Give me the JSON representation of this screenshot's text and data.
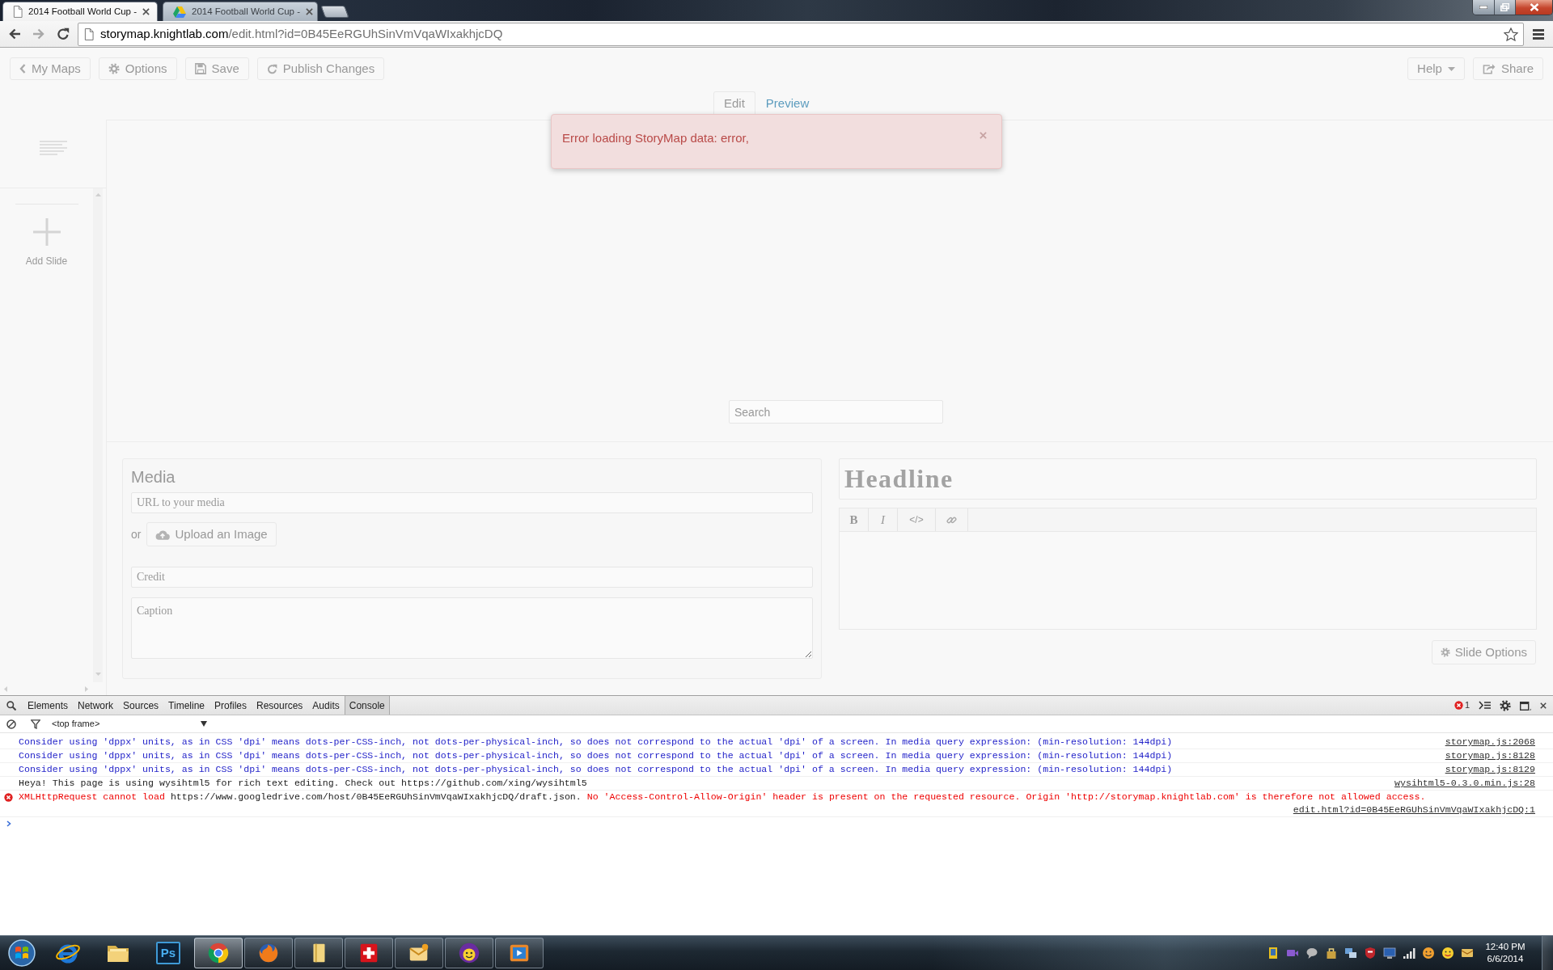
{
  "browser": {
    "tabs": [
      {
        "title": "2014 Football World Cup -",
        "selected": true
      },
      {
        "title": "2014 Football World Cup -",
        "selected": false
      }
    ],
    "address": {
      "host": "storymap.knightlab.com",
      "path": "/edit.html?id=0B45EeRGUhSinVmVqaWIxakhjcDQ"
    }
  },
  "toolbar": {
    "left_buttons": [
      {
        "label": "My Maps"
      },
      {
        "label": "Options"
      },
      {
        "label": "Save"
      },
      {
        "label": "Publish Changes"
      }
    ],
    "right_buttons": [
      {
        "label": "Help"
      },
      {
        "label": "Share"
      }
    ]
  },
  "mode_tabs": [
    {
      "label": "Edit",
      "selected": true
    },
    {
      "label": "Preview",
      "selected": false
    }
  ],
  "alert": {
    "message": "Error loading StoryMap data: error,"
  },
  "sidebar": {
    "add_slide": "Add Slide"
  },
  "map": {
    "search": {
      "placeholder": "Search"
    }
  },
  "media_panel": {
    "title": "Media",
    "url_field": {
      "placeholder": "URL to your media"
    },
    "or_text": "or",
    "upload_button": "Upload an Image",
    "credit_field": {
      "placeholder": "Credit"
    },
    "caption_field": {
      "placeholder": "Caption"
    }
  },
  "text_panel": {
    "headline": {
      "placeholder": "Headline"
    },
    "format_buttons": [
      {
        "kind": "bold",
        "label": "B"
      },
      {
        "kind": "italic",
        "label": "I"
      },
      {
        "kind": "code",
        "label": "</>"
      },
      {
        "kind": "link"
      }
    ],
    "slide_options_button": "Slide Options"
  },
  "devtools": {
    "tabs": [
      {
        "label": "Elements",
        "selected": false
      },
      {
        "label": "Network",
        "selected": false
      },
      {
        "label": "Sources",
        "selected": false
      },
      {
        "label": "Timeline",
        "selected": false
      },
      {
        "label": "Profiles",
        "selected": false
      },
      {
        "label": "Resources",
        "selected": false
      },
      {
        "label": "Audits",
        "selected": false
      },
      {
        "label": "Console",
        "selected": true
      }
    ],
    "error_count": "1",
    "context_selector": "<top frame>",
    "messages": [
      {
        "kind": "debug",
        "segments": [
          {
            "kind": "text",
            "text": "Consider using 'dppx' units, as in CSS 'dpi' means dots-per-CSS-inch, not dots-per-physical-inch, so does not correspond to the actual 'dpi' of a screen. In media query expression: (min-resolution: 144dpi)"
          }
        ],
        "source": "storymap.js:2068"
      },
      {
        "kind": "debug",
        "segments": [
          {
            "kind": "text",
            "text": "Consider using 'dppx' units, as in CSS 'dpi' means dots-per-CSS-inch, not dots-per-physical-inch, so does not correspond to the actual 'dpi' of a screen. In media query expression: (min-resolution: 144dpi)"
          }
        ],
        "source": "storymap.js:8128"
      },
      {
        "kind": "debug",
        "segments": [
          {
            "kind": "text",
            "text": "Consider using 'dppx' units, as in CSS 'dpi' means dots-per-CSS-inch, not dots-per-physical-inch, so does not correspond to the actual 'dpi' of a screen. In media query expression: (min-resolution: 144dpi)"
          }
        ],
        "source": "storymap.js:8129"
      },
      {
        "kind": "log",
        "segments": [
          {
            "kind": "text",
            "text": "Heya! This page is using wysihtml5 for rich text editing. Check out https://github.com/xing/wysihtml5"
          }
        ],
        "source": "wysihtml5-0.3.0.min.js:28"
      },
      {
        "kind": "error",
        "segments": [
          {
            "kind": "text",
            "text": "XMLHttpRequest cannot load"
          },
          {
            "kind": "url",
            "text": "https://www.googledrive.com/host/0B45EeRGUhSinVmVqaWIxakhjcDQ/draft.json."
          },
          {
            "kind": "text",
            "text": "No 'Access-Control-Allow-Origin' header is present on the requested resource. Origin 'http://storymap.knightlab.com' is therefore not allowed access."
          }
        ],
        "source": "edit.html?id=0B45EeRGUhSinVmVqaWIxakhjcDQ:1"
      }
    ]
  },
  "taskbar": {
    "apps": [
      {
        "running": false,
        "active": false
      },
      {
        "running": false,
        "active": false
      },
      {
        "label": "Ps",
        "running": false,
        "active": false
      },
      {
        "running": true,
        "active": true
      },
      {
        "running": true,
        "active": false
      },
      {
        "running": true,
        "active": false
      },
      {
        "running": true,
        "active": false
      },
      {
        "running": true,
        "active": false
      },
      {
        "running": true,
        "active": false
      },
      {
        "running": true,
        "active": false
      }
    ],
    "clock": {
      "time": "12:40 PM",
      "date": "6/6/2014"
    }
  }
}
